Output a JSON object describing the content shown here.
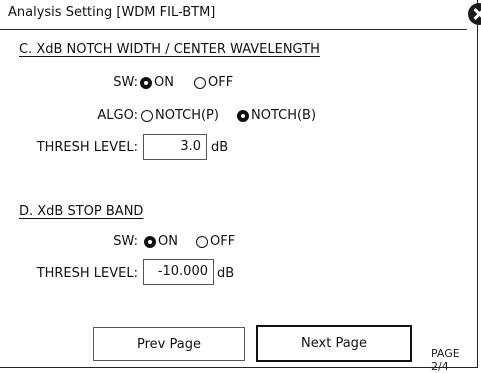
{
  "window": {
    "title": "Analysis Setting [WDM FIL-BTM]"
  },
  "section_c": {
    "title": "C. XdB NOTCH WIDTH / CENTER WAVELENGTH",
    "sw_label": "SW:",
    "sw_options": [
      {
        "label": "ON",
        "selected": true
      },
      {
        "label": "OFF",
        "selected": false
      }
    ],
    "algo_label": "ALGO:",
    "algo_options": [
      {
        "label": "NOTCH(P)",
        "selected": false
      },
      {
        "label": "NOTCH(B)",
        "selected": true
      }
    ],
    "thresh_label": "THRESH LEVEL:",
    "thresh_value": "3.0",
    "thresh_unit": "dB"
  },
  "section_d": {
    "title": "D. XdB STOP BAND",
    "sw_label": "SW:",
    "sw_options": [
      {
        "label": "ON",
        "selected": true
      },
      {
        "label": "OFF",
        "selected": false
      }
    ],
    "thresh_label": "THRESH LEVEL:",
    "thresh_value": "-10.000",
    "thresh_unit": "dB"
  },
  "footer": {
    "prev_label": "Prev Page",
    "next_label": "Next Page",
    "page_indicator": "PAGE 2/4"
  }
}
